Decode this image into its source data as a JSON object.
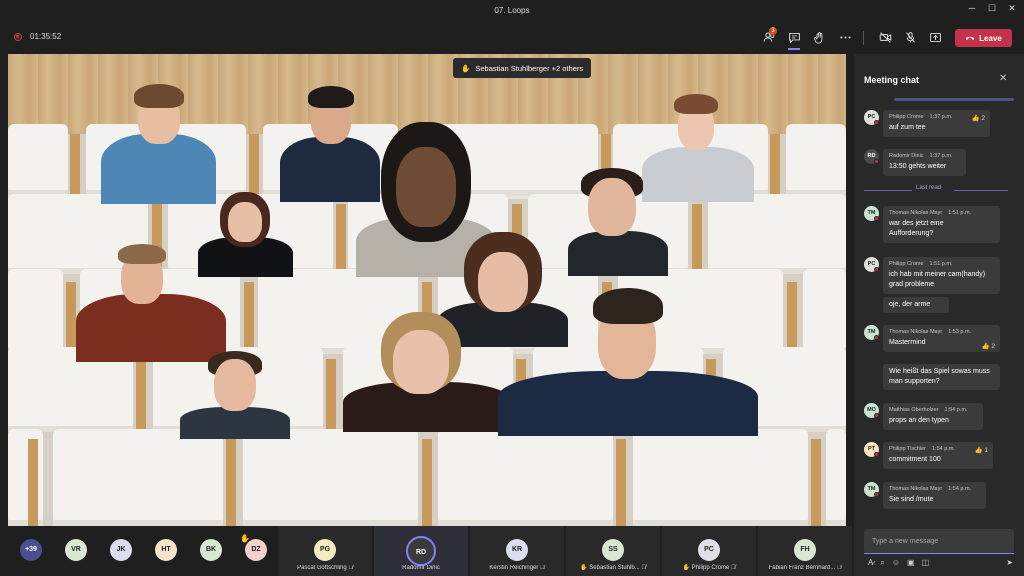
{
  "window": {
    "title": "07. Loops",
    "min": "─",
    "max": "☐",
    "close": "✕"
  },
  "toolbar": {
    "timer": "01:35:52",
    "participants_badge": "3",
    "leave_label": "Leave"
  },
  "banner": {
    "text": "Sebastian Stuhlberger +2 others"
  },
  "chat": {
    "title": "Meeting chat",
    "last_read": "Last read",
    "compose_placeholder": "Type a new message",
    "messages": [
      {
        "initials": "PC",
        "author": "Philipp Crome",
        "time": "1:37 p.m.",
        "lines": [
          "auf zum tee"
        ],
        "reaction": "2",
        "avatar_color": "#e1dfdd"
      },
      {
        "initials": "RD",
        "author": "Radomir Dinic",
        "time": "1:37 p.m.",
        "lines": [
          "13:50 gehts weiter"
        ],
        "reaction": "",
        "avatar_color": "#4a4a4a"
      },
      {
        "initials": "TM",
        "author": "Thomas Nikolas Mayr",
        "time": "1:51 p.m.",
        "lines": [
          "war des jetzt eine",
          "Aufforderung?"
        ],
        "reaction": "",
        "avatar_color": "#c7e5cf"
      },
      {
        "initials": "PC",
        "author": "Philipp Crome",
        "time": "1:51 p.m.",
        "lines": [
          "ich hab mit meiner cam(handy)",
          "grad probleme"
        ],
        "reaction": "",
        "avatar_color": "#e1dfdd"
      },
      {
        "initials": "",
        "author": "",
        "time": "",
        "lines": [
          "oje, der arme"
        ],
        "reaction": "",
        "avatar_color": ""
      },
      {
        "initials": "TM",
        "author": "Thomas Nikolas Mayr",
        "time": "1:53 p.m.",
        "lines": [
          "Mastermind"
        ],
        "reaction": "2",
        "avatar_color": "#c7e5cf"
      },
      {
        "initials": "",
        "author": "",
        "time": "",
        "lines": [
          "Wie heißt das Spiel sowas muss",
          "man supporten?"
        ],
        "reaction": "",
        "avatar_color": ""
      },
      {
        "initials": "MO",
        "author": "Matthias Oberholzer",
        "time": "1:54 p.m.",
        "lines": [
          "props an den typen"
        ],
        "reaction": "",
        "avatar_color": "#c7e5cf"
      },
      {
        "initials": "PT",
        "author": "Philipp Tischler",
        "time": "1:54 p.m.",
        "lines": [
          "commitment 100"
        ],
        "reaction": "1",
        "avatar_color": "#fbe3c0"
      },
      {
        "initials": "TM",
        "author": "Thomas Nikolas Mayr",
        "time": "1:54 p.m.",
        "lines": [
          "Sie sind /mute"
        ],
        "reaction": "",
        "avatar_color": "#c7e5cf"
      }
    ]
  },
  "bottom": {
    "more_count": "+39",
    "avatars": [
      {
        "initials": "VR",
        "color": "#d8e8d0"
      },
      {
        "initials": "JK",
        "color": "#dcdcf0"
      },
      {
        "initials": "HT",
        "color": "#f8e2c8"
      },
      {
        "initials": "BK",
        "color": "#d8e8d0"
      },
      {
        "initials": "DZ",
        "color": "#f4d0cc"
      }
    ],
    "tiles": [
      {
        "initials": "PG",
        "name": "Pascal Gottschling",
        "color": "#f4ecc0",
        "hand": false
      },
      {
        "initials": "RD",
        "name": "Radomir Dinic",
        "color": "#3a3a3a",
        "hand": false
      },
      {
        "initials": "KR",
        "name": "Kerstin Reichinger",
        "color": "#dcdcf0",
        "hand": false
      },
      {
        "initials": "SS",
        "name": "Sebastian Stuhlb...",
        "color": "#d8e8d0",
        "hand": true
      },
      {
        "initials": "PC",
        "name": "Philipp Crome",
        "color": "#e1dfe8",
        "hand": true
      },
      {
        "initials": "FH",
        "name": "Fabian Franz Bernhard...",
        "color": "#d8e8d0",
        "hand": false
      }
    ]
  }
}
